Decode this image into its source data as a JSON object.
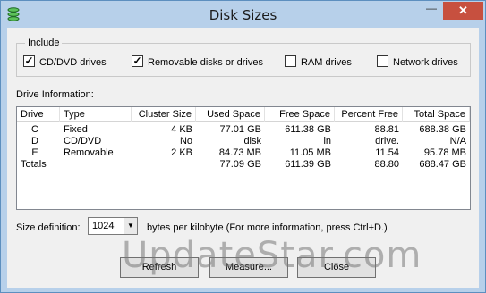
{
  "window": {
    "title": "Disk Sizes",
    "minimize_glyph": "—",
    "close_glyph": "✕"
  },
  "include": {
    "label": "Include",
    "checkboxes": [
      {
        "label": "CD/DVD drives",
        "checked": true
      },
      {
        "label": "Removable disks or drives",
        "checked": true
      },
      {
        "label": "RAM drives",
        "checked": false
      },
      {
        "label": "Network drives",
        "checked": false
      }
    ]
  },
  "drive_info": {
    "label": "Drive Information:",
    "columns": [
      "Drive",
      "Type",
      "Cluster Size",
      "Used Space",
      "Free Space",
      "Percent Free",
      "Total Space"
    ],
    "rows": [
      [
        "C",
        "Fixed",
        "4 KB",
        "77.01 GB",
        "611.38 GB",
        "88.81",
        "688.38 GB"
      ],
      [
        "D",
        "CD/DVD",
        "No",
        "disk",
        "in",
        "drive.",
        "N/A"
      ],
      [
        "E",
        "Removable",
        "2 KB",
        "84.73 MB",
        "11.05 MB",
        "11.54",
        "95.78 MB"
      ],
      [
        "Totals",
        "",
        "",
        "77.09 GB",
        "611.39 GB",
        "88.80",
        "688.47 GB"
      ]
    ]
  },
  "size_definition": {
    "label": "Size definition:",
    "value": "1024",
    "hint": "bytes per kilobyte  (For more information, press Ctrl+D.)"
  },
  "buttons": {
    "refresh": "Refresh",
    "measure": "Measure...",
    "close": "Close"
  },
  "watermark": "UpdateStar.com",
  "icons": {
    "app": "disk-stack-icon",
    "dropdown": "chevron-down-icon"
  },
  "colors": {
    "titlebar": "#b7d0ea",
    "close_button": "#c7503f",
    "app_icon": "#2e9a3a"
  }
}
